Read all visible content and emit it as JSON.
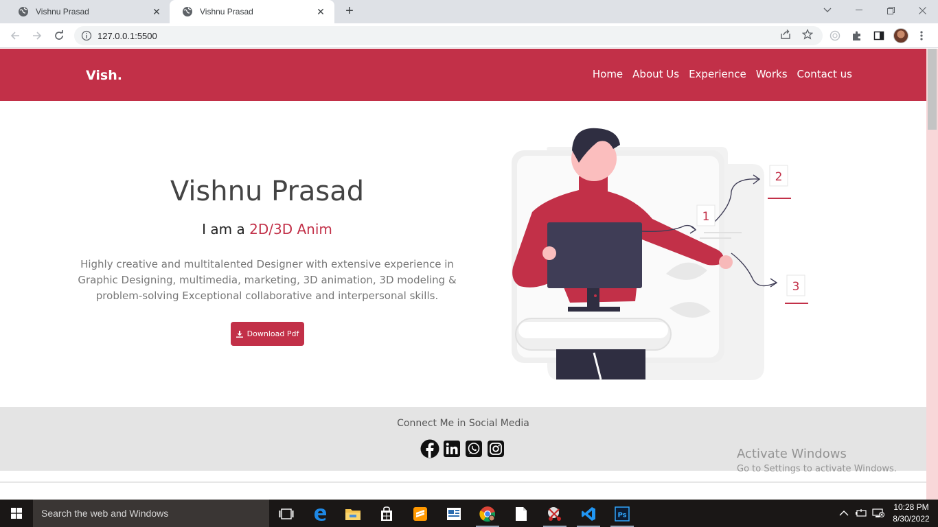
{
  "browser": {
    "tabs": [
      {
        "title": "Vishnu Prasad",
        "active": false
      },
      {
        "title": "Vishnu Prasad",
        "active": true
      }
    ],
    "url": "127.0.0.1:5500"
  },
  "site": {
    "brand": "Vish.",
    "nav": [
      "Home",
      "About Us",
      "Experience",
      "Works",
      "Contact us"
    ],
    "hero": {
      "name": "Vishnu Prasad",
      "role_prefix": "I am a ",
      "role_typed": "2D/3D Anim",
      "description": "Highly creative and multitalented Designer with extensive experience in Graphic Designing, multimedia, marketing, 3D animation, 3D modeling & problem-solving Exceptional collaborative and interpersonal skills.",
      "download_label": "Download Pdf"
    },
    "illustration_labels": [
      "1",
      "2",
      "3"
    ],
    "social": {
      "title": "Connect Me in Social Media",
      "icons": [
        "facebook-icon",
        "linkedin-icon",
        "whatsapp-icon",
        "instagram-icon"
      ]
    },
    "colors": {
      "accent": "#c23048"
    }
  },
  "watermark": {
    "line1": "Activate Windows",
    "line2": "Go to Settings to activate Windows."
  },
  "taskbar": {
    "search_placeholder": "Search the web and Windows",
    "time": "10:28 PM",
    "date": "8/30/2022"
  }
}
